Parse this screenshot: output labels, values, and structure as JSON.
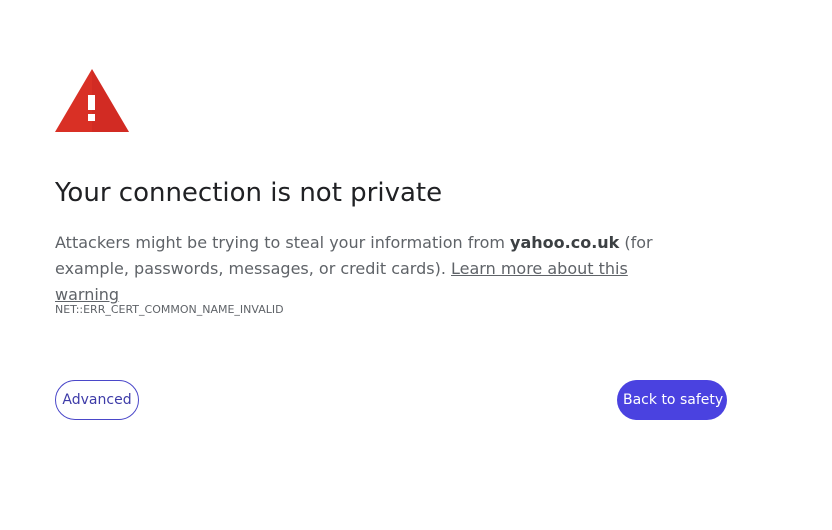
{
  "interstitial": {
    "icon": "warning-triangle-icon",
    "title": "Your connection is not private",
    "body_prefix": "Attackers might be trying to steal your information from ",
    "domain": "yahoo.co.uk",
    "body_suffix": " (for example, passwords, messages, or credit cards). ",
    "learn_more_label": "Learn more about this warning",
    "error_code": "NET::ERR_CERT_COMMON_NAME_INVALID",
    "advanced_label": "Advanced",
    "back_to_safety_label": "Back to safety"
  },
  "colors": {
    "warning_red": "#d93025",
    "primary_button": "#4a42e0",
    "title_text": "#202124",
    "body_text": "#5f6368"
  }
}
